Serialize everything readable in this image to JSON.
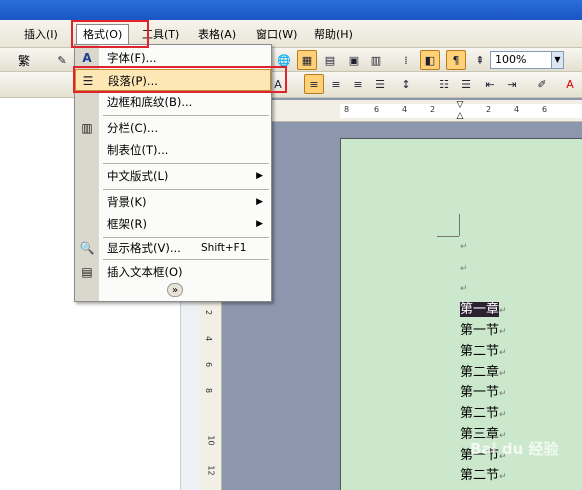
{
  "menubar": {
    "items": [
      {
        "label": "插入(I)"
      },
      {
        "label": "格式(O)"
      },
      {
        "label": "工具(T)"
      },
      {
        "label": "表格(A)"
      },
      {
        "label": "窗口(W)"
      },
      {
        "label": "帮助(H)"
      }
    ]
  },
  "toolbar": {
    "zoom": "100%",
    "fan_label": "繁",
    "a_label": "A"
  },
  "format_menu": {
    "items": [
      {
        "label": "字体(F)...",
        "icon": "font-icon"
      },
      {
        "label": "段落(P)...",
        "icon": "paragraph-icon"
      },
      {
        "label": "边框和底纹(B)...",
        "icon": ""
      },
      {
        "label": "分栏(C)...",
        "icon": "columns-icon"
      },
      {
        "label": "制表位(T)...",
        "icon": ""
      },
      {
        "label": "中文版式(L)",
        "icon": ""
      },
      {
        "label": "背景(K)",
        "icon": ""
      },
      {
        "label": "框架(R)",
        "icon": ""
      },
      {
        "label": "显示格式(V)...",
        "shortcut": "Shift+F1",
        "icon": "reveal-format-icon"
      },
      {
        "label": "插入文本框(O)",
        "icon": "textbox-icon"
      }
    ]
  },
  "ruler": {
    "h_numbers": [
      "8",
      "6",
      "4",
      "2",
      "2",
      "4",
      "6"
    ],
    "v_numbers": [
      "2",
      "4",
      "6",
      "8",
      "10",
      "12"
    ]
  },
  "document": {
    "lines": [
      "第一章",
      "第一节",
      "第二节",
      "第二章",
      "第一节",
      "第二节",
      "第三章",
      "第一节",
      "第二节"
    ]
  },
  "watermark": "Bai du 经验"
}
